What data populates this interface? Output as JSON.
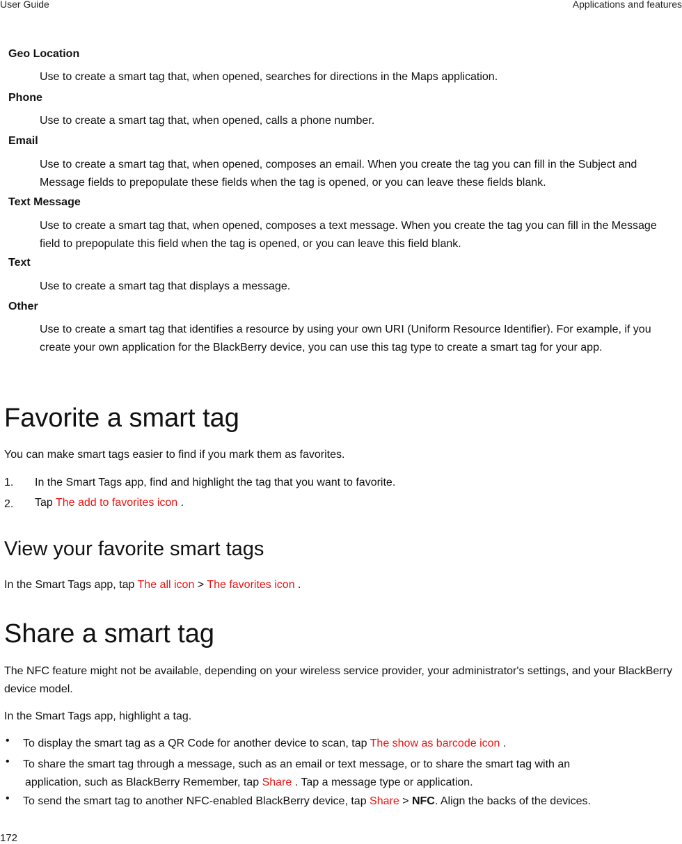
{
  "header": {
    "left": "User Guide",
    "right": "Applications and features"
  },
  "definitions": [
    {
      "term": "Geo Location",
      "desc": "Use to create a smart tag that, when opened, searches for directions in the Maps application."
    },
    {
      "term": "Phone",
      "desc": "Use to create a smart tag that, when opened, calls a phone number."
    },
    {
      "term": "Email",
      "desc": "Use to create a smart tag that, when opened, composes an email. When you create the tag you can fill in the Subject and Message fields to prepopulate these fields when the tag is opened, or you can leave these fields blank."
    },
    {
      "term": "Text Message",
      "desc": "Use to create a smart tag that, when opened, composes a text message. When you create the tag you can fill in the Message field to prepopulate this field when the tag is opened, or you can leave this field blank."
    },
    {
      "term": "Text",
      "desc": "Use to create a smart tag that displays a message."
    },
    {
      "term": "Other",
      "desc": "Use to create a smart tag that identifies a resource by using your own URI (Uniform Resource Identifier). For example, if you create your own application for the BlackBerry device, you can use this tag type to create a smart tag for your app."
    }
  ],
  "favorite": {
    "title": "Favorite a smart tag",
    "intro": "You can make smart tags easier to find if you mark them as favorites.",
    "steps": [
      {
        "num": "1.",
        "text": "In the Smart Tags app, find and highlight the tag that you want to favorite."
      },
      {
        "num": "2.",
        "pre": "Tap ",
        "icon": "The add to favorites icon",
        "post": " ."
      }
    ]
  },
  "view": {
    "title": "View your favorite smart tags",
    "pre": "In the Smart Tags app, tap ",
    "icon1": "The all icon",
    "sep": " > ",
    "icon2": "The favorites icon",
    "post": " ."
  },
  "share": {
    "title": "Share a smart tag",
    "intro": "The NFC feature might not be available, depending on your wireless service provider, your administrator's settings, and your BlackBerry device model.",
    "lead": "In the Smart Tags app, highlight a tag.",
    "bullets": [
      {
        "pre": "To display the smart tag as a QR Code for another device to scan, tap ",
        "icon": "The show as barcode icon",
        "post": " ."
      },
      {
        "line1": "To share the smart tag through a message, such as an email or text message, or to share the smart tag with an",
        "pre": "application, such as BlackBerry Remember, tap ",
        "icon": "Share",
        "post": " . Tap a message type or application."
      },
      {
        "pre": "To send the smart tag to another NFC-enabled BlackBerry device, tap ",
        "icon": "Share",
        "sep": " > ",
        "bold": "NFC",
        "post": ". Align the backs of the devices."
      }
    ],
    "bullet_char": "•"
  },
  "page_number": "172",
  "colors": {
    "icon_placeholder": "#ee1111"
  }
}
